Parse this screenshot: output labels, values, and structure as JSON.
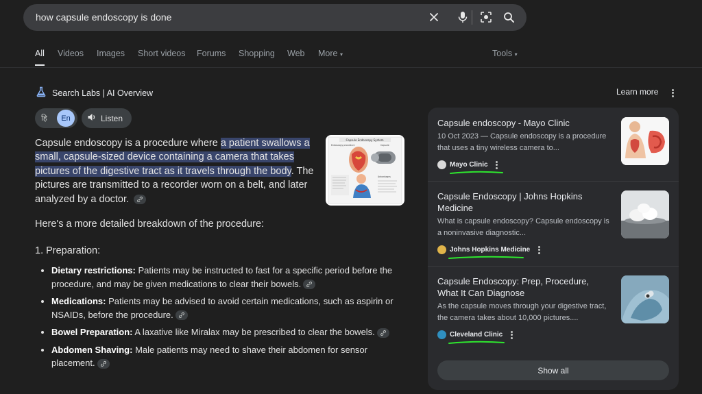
{
  "search": {
    "query": "how capsule endoscopy is done"
  },
  "tabs": [
    {
      "label": "All",
      "active": true
    },
    {
      "label": "Videos"
    },
    {
      "label": "Images"
    },
    {
      "label": "Short videos"
    },
    {
      "label": "Forums"
    },
    {
      "label": "Shopping"
    },
    {
      "label": "Web"
    },
    {
      "label": "More"
    }
  ],
  "tools_label": "Tools",
  "overview": {
    "title": "Search Labs | AI Overview",
    "learn_more": "Learn more",
    "lang_hi": "हि",
    "lang_en": "En",
    "listen": "Listen",
    "intro_before": "Capsule endoscopy is a procedure where ",
    "intro_highlight": "a patient swallows a small, capsule-sized device containing a camera that takes pictures of the digestive tract as it travels through the body",
    "intro_after": ". The pictures are transmitted to a recorder worn on a belt, and later analyzed by a doctor.",
    "breakdown": "Here's a more detailed breakdown of the procedure:",
    "step1": "1. Preparation:",
    "bullets": [
      {
        "term": "Dietary restrictions:",
        "text": " Patients may be instructed to fast for a specific period before the procedure, and may be given medications to clear their bowels."
      },
      {
        "term": "Medications:",
        "text": " Patients may be advised to avoid certain medications, such as aspirin or NSAIDs, before the procedure."
      },
      {
        "term": "Bowel Preparation:",
        "text": " A laxative like Miralax may be prescribed to clear the bowels."
      },
      {
        "term": "Abdomen Shaving:",
        "text": " Male patients may need to shave their abdomen for sensor placement."
      }
    ],
    "diagram_title": "Capsule Endoscopy System",
    "diagram_label_left": "Endoscopy procedure",
    "diagram_label_right": "Capsule",
    "diagram_label_adv": "Advantages"
  },
  "sources": [
    {
      "title": "Capsule endoscopy - Mayo Clinic",
      "snippet": "10 Oct 2023 — Capsule endoscopy is a procedure that uses a tiny wireless camera to...",
      "site": "Mayo Clinic",
      "color": "#d9d9d9"
    },
    {
      "title": "Capsule Endoscopy | Johns Hopkins Medicine",
      "snippet": "What is capsule endoscopy? Capsule endoscopy is a noninvasive diagnostic...",
      "site": "Johns Hopkins Medicine",
      "color": "#e0b44a"
    },
    {
      "title": "Capsule Endoscopy: Prep, Procedure, What It Can Diagnose",
      "snippet": "As the capsule moves through your digestive tract, the camera takes about 10,000 pictures....",
      "site": "Cleveland Clinic",
      "color": "#2f8fbf"
    }
  ],
  "show_all": "Show all",
  "colors": {
    "accent_highlight": "#39456b",
    "annotation_green": "#2ee82e",
    "lang_active": "#a8c7fa"
  }
}
